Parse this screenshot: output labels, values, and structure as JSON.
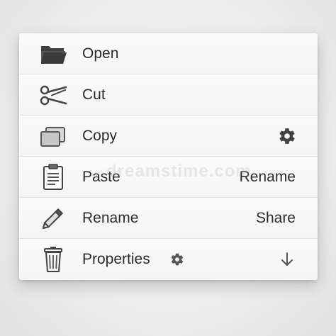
{
  "menu": {
    "items": [
      {
        "label": "Open",
        "icon": "folder-icon"
      },
      {
        "label": "Cut",
        "icon": "scissors-icon"
      },
      {
        "label": "Copy",
        "icon": "copy-icon",
        "right_icon": "gear-icon"
      },
      {
        "label": "Paste",
        "icon": "clipboard-icon",
        "right_text": "Rename"
      },
      {
        "label": "Rename",
        "icon": "pencil-icon",
        "right_text": "Share"
      },
      {
        "label": "Properties",
        "icon": "trash-icon",
        "inline_icon": "gear-icon",
        "right_icon": "arrow-down-icon"
      }
    ]
  },
  "watermark": "dreamstime.com",
  "colors": {
    "text": "#2b2b2b",
    "icon": "#4a4a4a",
    "divider": "#e2e2e2",
    "menu_background": "#f9f9f9"
  }
}
